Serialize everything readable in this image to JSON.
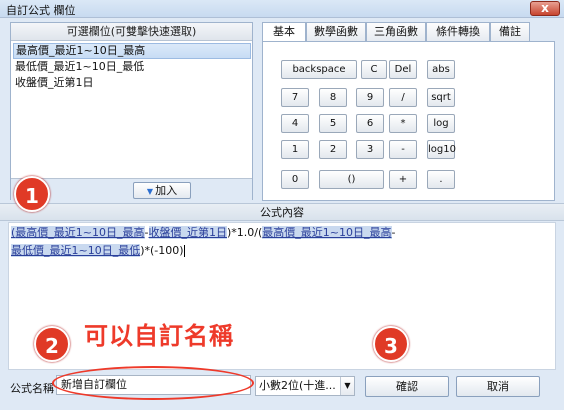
{
  "window": {
    "title": "自訂公式 欄位",
    "close_label": "x"
  },
  "field_list": {
    "header": "可選欄位(可雙擊快速選取)",
    "items": [
      "最高價_最近1~10日_最高",
      "最低價_最近1~10日_最低",
      "收盤價_近第1日"
    ],
    "add_label": "加入"
  },
  "tabs": [
    "基本",
    "數學函數",
    "三角函數",
    "條件轉換",
    "備註"
  ],
  "keypad": {
    "rows": [
      [
        "backspace",
        "C",
        "Del",
        "abs"
      ],
      [
        "7",
        "8",
        "9",
        "/",
        "sqrt"
      ],
      [
        "4",
        "5",
        "6",
        "*",
        "log"
      ],
      [
        "1",
        "2",
        "3",
        "-",
        "log10"
      ],
      [
        "0",
        "()",
        "+",
        "."
      ]
    ]
  },
  "formula": {
    "header": "公式內容",
    "line1": [
      {
        "t": "(",
        "hl": true
      },
      {
        "t": "最高價_最近1~10日_最高",
        "hl": true
      },
      {
        "t": "-",
        "hl": false
      },
      {
        "t": "收盤價_近第1日",
        "hl": true
      },
      {
        "t": ")*1.0/(",
        "hl": false
      },
      {
        "t": "最高價_最近1~10日_最高",
        "hl": true
      },
      {
        "t": "-",
        "hl": false
      }
    ],
    "line2": [
      {
        "t": "最低價_最近1~10日_最低",
        "hl": true
      },
      {
        "t": ")*(-100)",
        "hl": false
      }
    ]
  },
  "callouts": {
    "badge1": "1",
    "badge2": "2",
    "badge3": "3",
    "text": "可以自訂名稱"
  },
  "bottom": {
    "name_label": "公式名稱",
    "name_value": "新增自訂欄位",
    "decimal_value": "小數2位(十進...",
    "confirm_label": "確認",
    "cancel_label": "取消"
  }
}
